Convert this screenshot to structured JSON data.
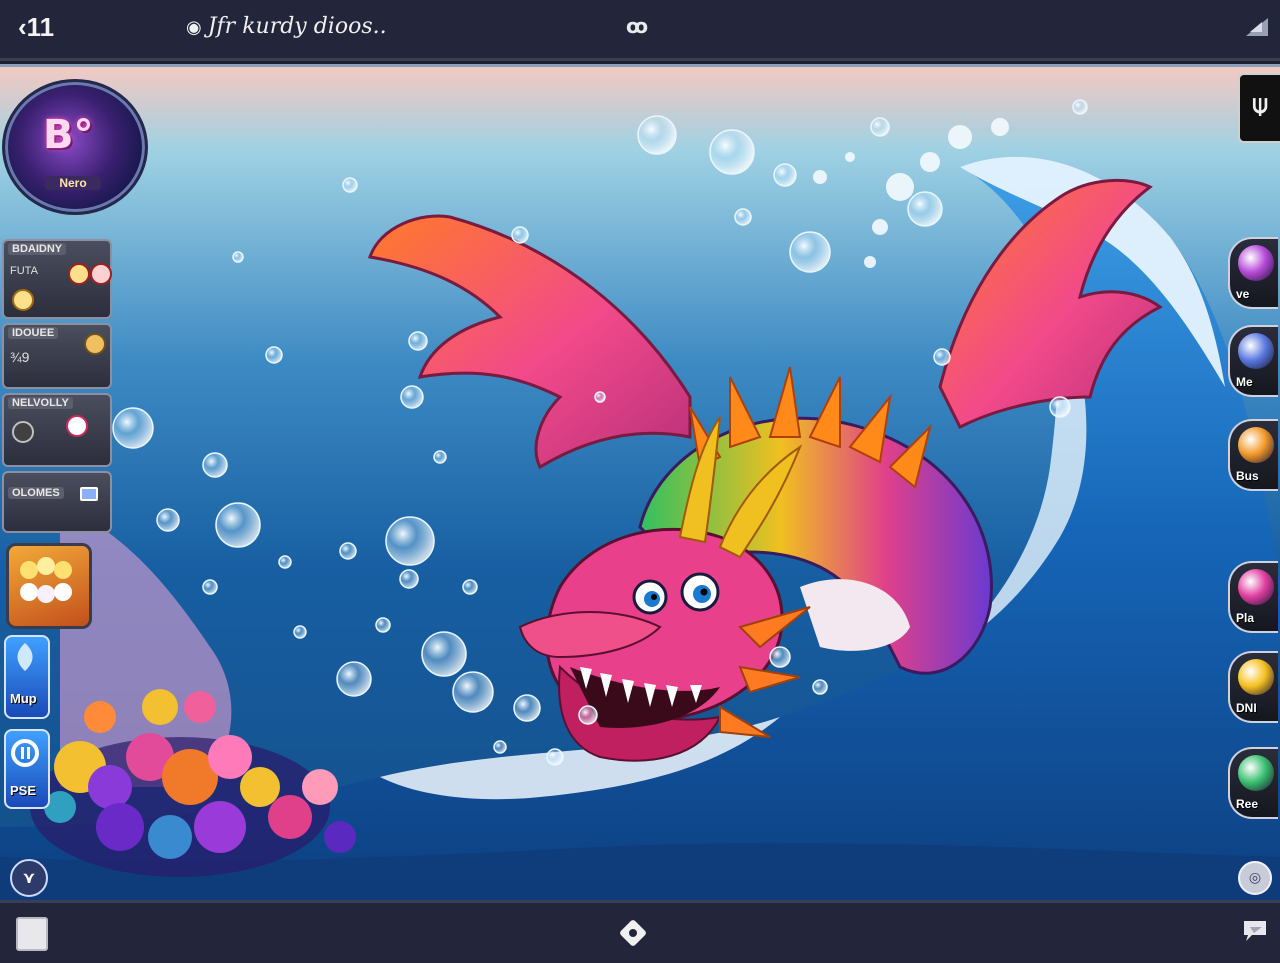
{
  "topbar": {
    "back_label": "‹11",
    "title": "Jfr kurdy dioos..",
    "center_symbol": "ꝏ"
  },
  "player": {
    "level": "B°",
    "name": "Nero"
  },
  "left_hud": {
    "panel1": {
      "label": "BDAIDNY",
      "sub": "FUTA"
    },
    "panel2": {
      "label": "IDOUEE",
      "sub": "¾9"
    },
    "panel3": {
      "label": "NELVOLLY"
    },
    "panel4": {
      "label": "OLOMES"
    },
    "ability1_label": "Mup",
    "ability2_label": "PSE",
    "settings_symbol": "⋎"
  },
  "right_hud": {
    "top_symbol": "⍦",
    "buttons": [
      {
        "label": "ve",
        "color": "#b84bd8"
      },
      {
        "label": "Me",
        "color": "#5a7ae0"
      },
      {
        "label": "Bus",
        "color": "#f29a2a"
      },
      {
        "label": "Pla",
        "color": "#e040a0"
      },
      {
        "label": "DNI",
        "color": "#f5c020"
      },
      {
        "label": "Ree",
        "color": "#3ac070"
      }
    ],
    "help_symbol": "◎"
  },
  "colors": {
    "wing": "#f04a7a",
    "dragon_body": "#7a3ad0",
    "wave": "#1b6fc0",
    "foam": "#f0f8ff"
  }
}
